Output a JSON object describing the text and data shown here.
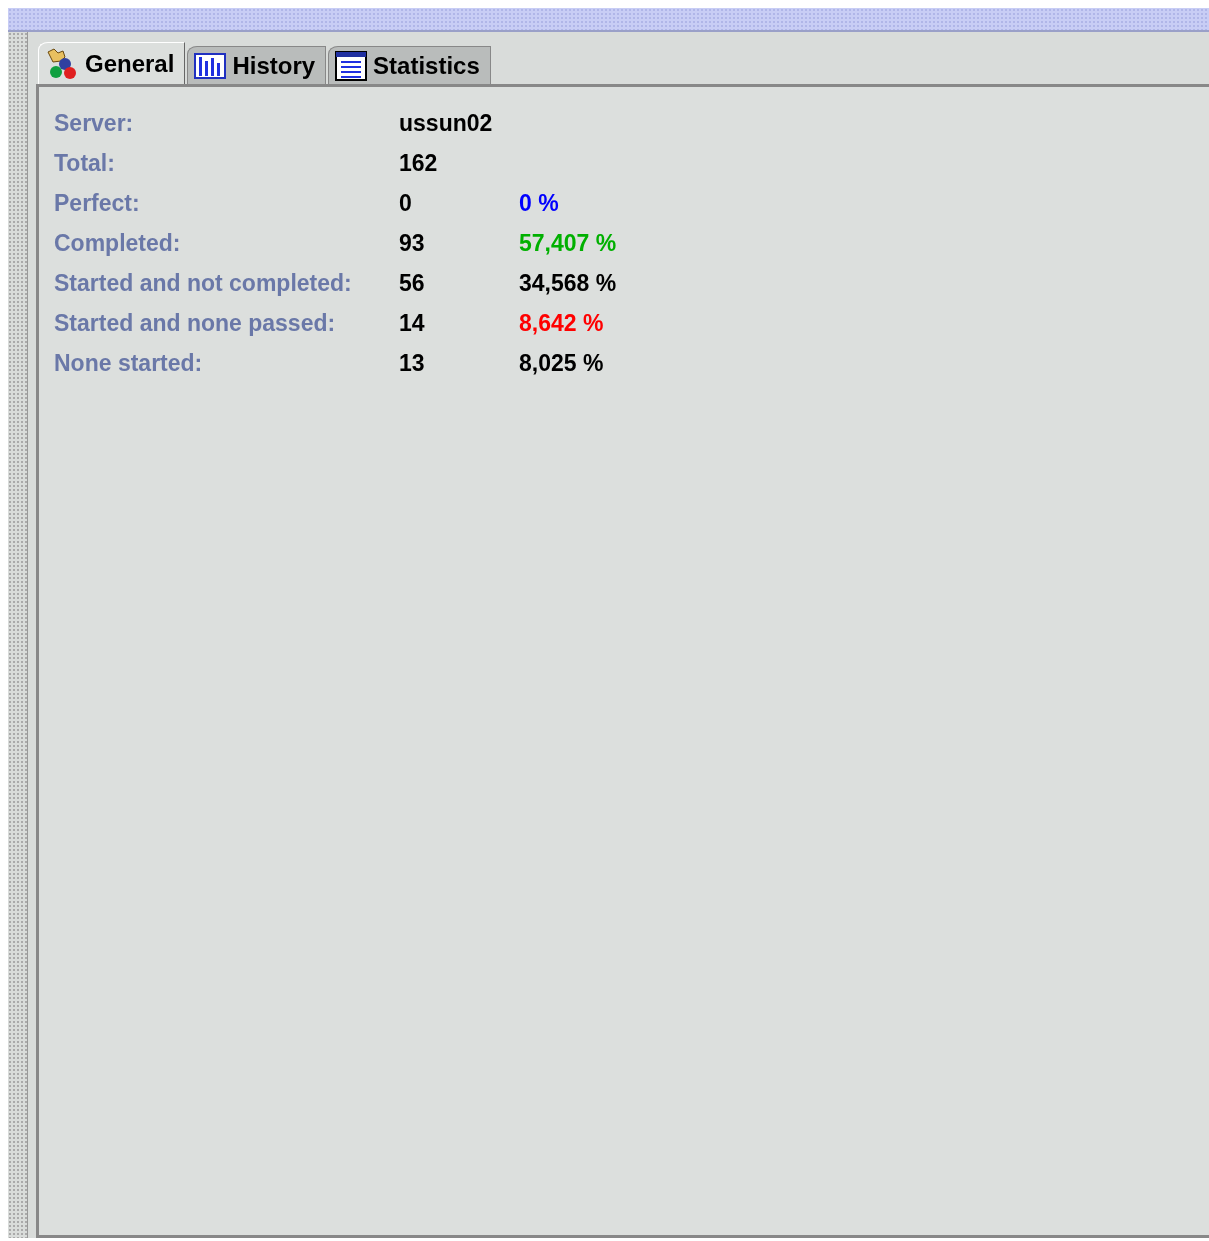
{
  "tabs": [
    {
      "label": "General",
      "selected": true,
      "kind": "general"
    },
    {
      "label": "History",
      "selected": false,
      "kind": "history"
    },
    {
      "label": "Statistics",
      "selected": false,
      "kind": "statistics"
    }
  ],
  "rows": [
    {
      "label": "Server:",
      "value": "ussun02"
    },
    {
      "label": "Total:",
      "value": "162"
    },
    {
      "label": "Perfect:",
      "value": "0",
      "percent": "0 %",
      "color": "#0000ff"
    },
    {
      "label": "Completed:",
      "value": "93",
      "percent": "57,407 %",
      "color": "#00b000"
    },
    {
      "label": "Started and not completed:",
      "value": "56",
      "percent": "34,568 %",
      "color": "#000000"
    },
    {
      "label": "Started and none passed:",
      "value": "14",
      "percent": "8,642 %",
      "color": "#ff0000"
    },
    {
      "label": "None started:",
      "value": "13",
      "percent": "8,025 %",
      "color": "#000000"
    }
  ]
}
